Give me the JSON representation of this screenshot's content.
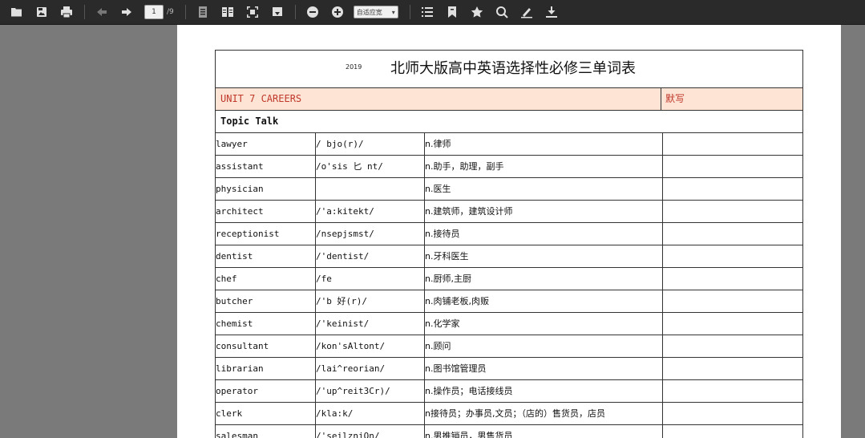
{
  "toolbar": {
    "page_current": "1",
    "page_total": "/9",
    "zoom_value": "自适应宽",
    "zoom_caret": "▾"
  },
  "document": {
    "year": "2019",
    "title": "北师大版高中英语选择性必修三单词表",
    "unit_label": "UNIT 7 CAREERS",
    "dictation_label": "默写",
    "topic_label": "Topic Talk",
    "words": [
      {
        "word": "lawyer",
        "phonetic": "/  bjo(r)/",
        "meaning": "n.律师"
      },
      {
        "word": "assistant",
        "phonetic": "/o'sis 匕 nt/",
        "meaning": "n.助手，助理，副手"
      },
      {
        "word": "physician",
        "phonetic": "",
        "meaning": "n.医生"
      },
      {
        "word": "architect",
        "phonetic": "/'a:kitekt/",
        "meaning": "n.建筑师，建筑设计师"
      },
      {
        "word": "receptionist",
        "phonetic": "/nsepjsmst/",
        "meaning": "n.接待员"
      },
      {
        "word": "dentist",
        "phonetic": "/'dentist/",
        "meaning": "n.牙科医生"
      },
      {
        "word": "chef",
        "phonetic": "/fe",
        "meaning": "n.厨师,主厨"
      },
      {
        "word": "butcher",
        "phonetic": "/'b 好(r)/",
        "meaning": "n.肉铺老板,肉贩"
      },
      {
        "word": "chemist",
        "phonetic": "/'keinist/",
        "meaning": "n.化学家"
      },
      {
        "word": "consultant",
        "phonetic": "/kon'sAltont/",
        "meaning": "n.顾问"
      },
      {
        "word": "librarian",
        "phonetic": "/lai^reorian/",
        "meaning": "n.图书馆管理员"
      },
      {
        "word": "operator",
        "phonetic": "/'up^reit3Cr)/",
        "meaning": "n.操作员；电话接线员"
      },
      {
        "word": "clerk",
        "phonetic": "/kla:k/",
        "meaning": "n接待员；办事员,文员；（店的）售货员，店员"
      },
      {
        "word": "salesman",
        "phonetic": "/'seilzniQn/",
        "meaning": "n.男推销员，男售货员"
      }
    ]
  }
}
